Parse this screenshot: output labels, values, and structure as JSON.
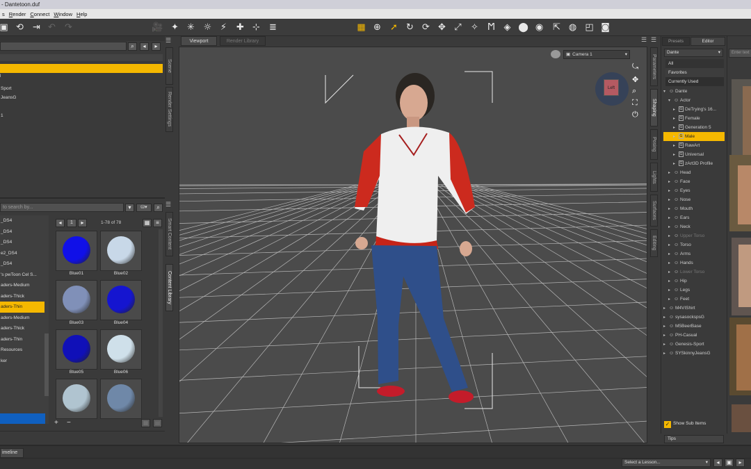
{
  "window": {
    "title": "- Dantetoon.duf"
  },
  "menu": [
    {
      "label": "s",
      "u": ""
    },
    {
      "label": "ender",
      "u": "R"
    },
    {
      "label": "onnect",
      "u": "C"
    },
    {
      "label": "indow",
      "u": "W"
    },
    {
      "label": "elp",
      "u": "H"
    }
  ],
  "scene_panel": {
    "tab": "Scene",
    "tab2": "Render Settings",
    "items": [
      "Sport",
      "JeansG",
      "1"
    ]
  },
  "content_panel": {
    "search_placeholder": "to search by...",
    "tabs": [
      "Smart Content",
      "Content Library"
    ],
    "page": "1",
    "range": "1-78 of 78",
    "folders": [
      "_DS4",
      "_DS4",
      "_DS4",
      "e2_DS4",
      "_DS4",
      "'s pwToon Cel S...",
      "aders-Medium",
      "aders-Thick",
      "aders-Thin",
      "aders-Medium",
      "aders-Thick",
      "aders-Thin",
      "Resources",
      "ker"
    ],
    "selected_folder_index": 8,
    "thumbs": [
      {
        "label": "Blue01",
        "color": "#1010e8"
      },
      {
        "label": "Blue02",
        "color": "#c8d8e8"
      },
      {
        "label": "Blue03",
        "color": "#8090b8"
      },
      {
        "label": "Blue04",
        "color": "#1515d0"
      },
      {
        "label": "Blue05",
        "color": "#1010b8"
      },
      {
        "label": "Blue06",
        "color": "#cfe0ea"
      },
      {
        "label": "",
        "color": "#b0c4d0"
      },
      {
        "label": "",
        "color": "#6f88a8"
      }
    ]
  },
  "viewport": {
    "tabs": [
      "Viewport",
      "Render Library"
    ],
    "camera": "Camera 1",
    "cube_label": "Left"
  },
  "right_tabs": [
    "Parameters",
    "Shaping",
    "Posing",
    "Lights",
    "Surfaces",
    "Editing"
  ],
  "shaping": {
    "tabs": [
      "Presets",
      "Editor"
    ],
    "dropdown": "Dante",
    "filters": [
      "All",
      "Favorites",
      "Currently Used"
    ],
    "tree": [
      {
        "label": "Dante",
        "level": 0,
        "kind": "fig",
        "expanded": true
      },
      {
        "label": "Actor",
        "level": 1,
        "kind": "fig",
        "expanded": true
      },
      {
        "label": "DeTrying's 16...",
        "level": 2,
        "kind": "g"
      },
      {
        "label": "Female",
        "level": 2,
        "kind": "g"
      },
      {
        "label": "Generation 5",
        "level": 2,
        "kind": "g"
      },
      {
        "label": "Male",
        "level": 2,
        "kind": "g",
        "selected": true
      },
      {
        "label": "RawArt",
        "level": 2,
        "kind": "g"
      },
      {
        "label": "Universal",
        "level": 2,
        "kind": "g"
      },
      {
        "label": "zArt3D Profile",
        "level": 2,
        "kind": "g"
      },
      {
        "label": "Head",
        "level": 1,
        "kind": "fig"
      },
      {
        "label": "Face",
        "level": 1,
        "kind": "fig"
      },
      {
        "label": "Eyes",
        "level": 1,
        "kind": "fig"
      },
      {
        "label": "Nose",
        "level": 1,
        "kind": "fig"
      },
      {
        "label": "Mouth",
        "level": 1,
        "kind": "fig"
      },
      {
        "label": "Ears",
        "level": 1,
        "kind": "fig"
      },
      {
        "label": "Neck",
        "level": 1,
        "kind": "fig"
      },
      {
        "label": "Upper Torso",
        "level": 1,
        "kind": "fig",
        "dim": true
      },
      {
        "label": "Torso",
        "level": 1,
        "kind": "fig"
      },
      {
        "label": "Arms",
        "level": 1,
        "kind": "fig"
      },
      {
        "label": "Hands",
        "level": 1,
        "kind": "fig"
      },
      {
        "label": "Lower Torso",
        "level": 1,
        "kind": "fig",
        "dim": true
      },
      {
        "label": "Hip",
        "level": 1,
        "kind": "fig"
      },
      {
        "label": "Legs",
        "level": 1,
        "kind": "fig"
      },
      {
        "label": "Feet",
        "level": 1,
        "kind": "fig"
      },
      {
        "label": "M4VIShirt",
        "level": 0,
        "kind": "fig"
      },
      {
        "label": "sysasockspsG",
        "level": 0,
        "kind": "fig"
      },
      {
        "label": "M5BeerBase",
        "level": 0,
        "kind": "fig"
      },
      {
        "label": "PH-Casual",
        "level": 0,
        "kind": "fig"
      },
      {
        "label": "Genesis-Sport",
        "level": 0,
        "kind": "fig"
      },
      {
        "label": "SYSkinnyJeansG",
        "level": 0,
        "kind": "fig"
      }
    ],
    "show_sub_items": "Show Sub Items",
    "tips": "Tips"
  },
  "far_right": {
    "search_placeholder": "Enter text"
  },
  "bottom": {
    "timeline": "imeline",
    "lesson": "Select a Lesson..."
  }
}
